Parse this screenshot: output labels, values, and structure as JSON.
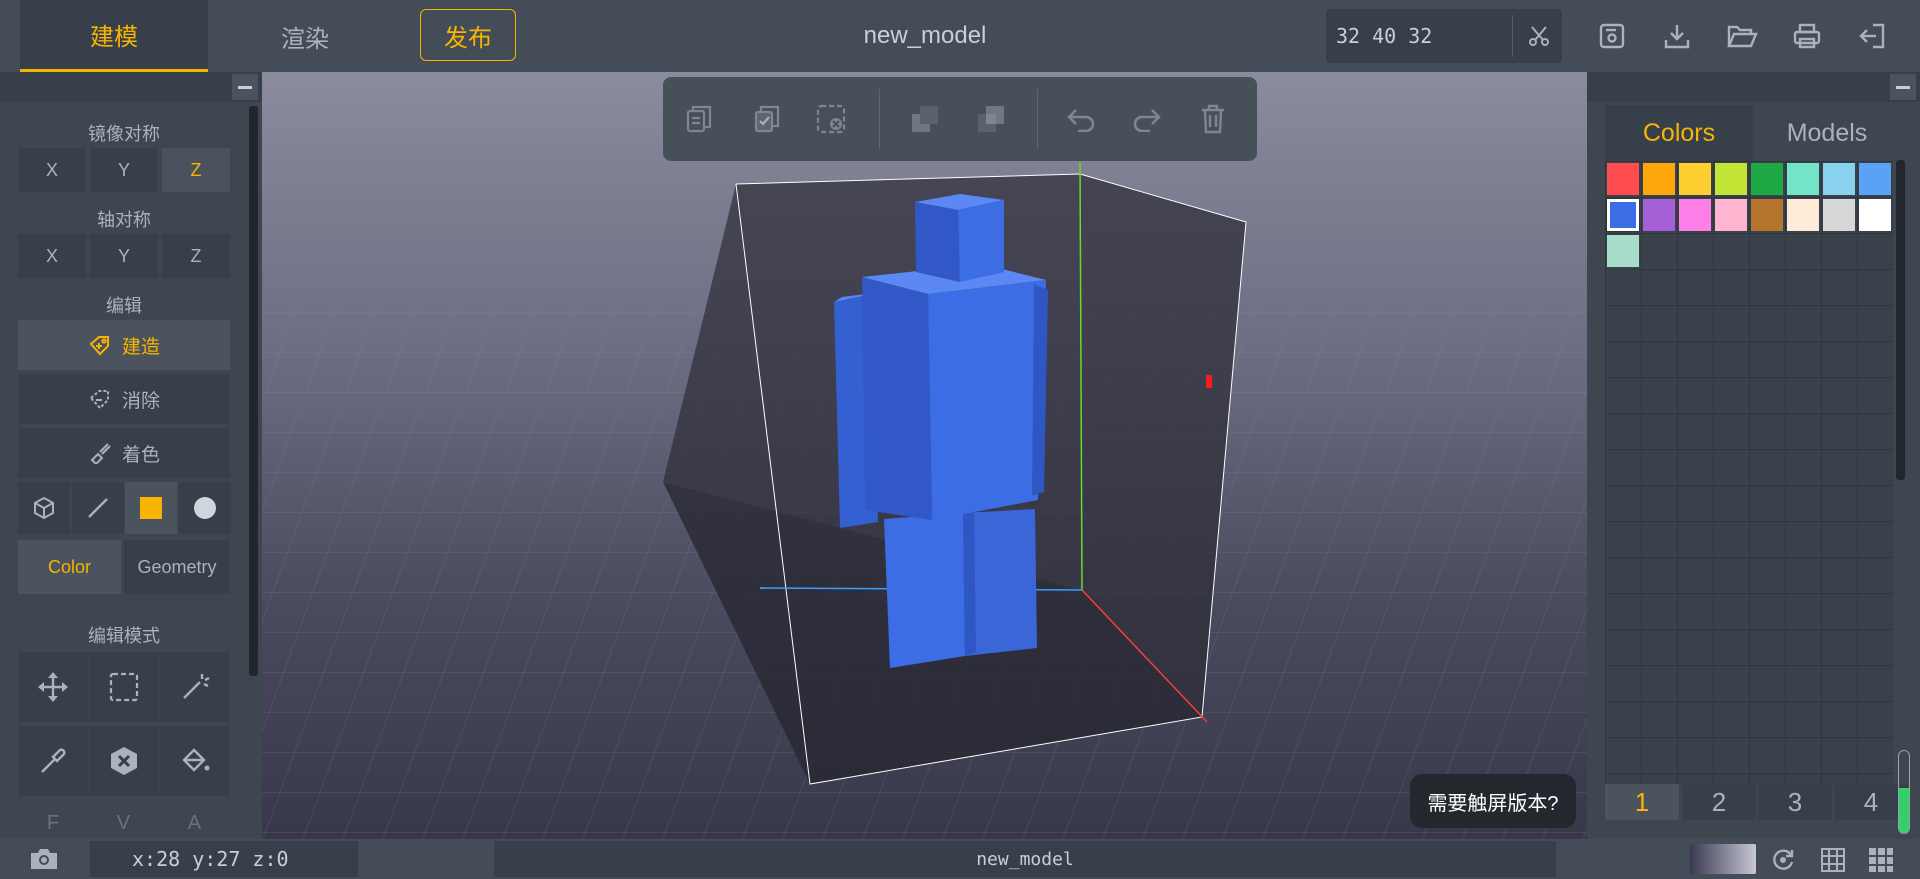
{
  "topbar": {
    "tab_model": "建模",
    "tab_render": "渲染",
    "publish": "发布",
    "title": "new_model",
    "dims": "32 40 32",
    "icons": [
      "scissors-icon",
      "save-icon",
      "download-icon",
      "folder-open-icon",
      "print-icon",
      "logout-icon"
    ]
  },
  "left": {
    "mirror_label": "镜像对称",
    "mirror_axes": [
      "X",
      "Y",
      "Z"
    ],
    "mirror_active": "Z",
    "axis_label": "轴对称",
    "axis_axes": [
      "X",
      "Y",
      "Z"
    ],
    "edit_label": "编辑",
    "build": "建造",
    "erase": "消除",
    "paint": "着色",
    "color_tab": "Color",
    "geometry_tab": "Geometry",
    "edit_mode_label": "编辑模式",
    "ghost_letters": [
      "F",
      "V",
      "A"
    ]
  },
  "viewport": {
    "touch_tip": "需要触屏版本?",
    "accent_color": "#f7b400",
    "model_color": "#3d6de4"
  },
  "right": {
    "tab_colors": "Colors",
    "tab_models": "Models",
    "palette": [
      "#ff4d4f",
      "#ffa60a",
      "#ffcf32",
      "#c3e536",
      "#1fa846",
      "#72e4c8",
      "#88d2f0",
      "#5aa2f5",
      "#3d6de4",
      "#a560d8",
      "#ff7fe8",
      "#ffb4cf",
      "#b4742b",
      "#fdebd8",
      "#d7d7d7",
      "#ffffff",
      "#a6dcc8"
    ],
    "selected_index": 8,
    "pages": [
      "1",
      "2",
      "3",
      "4"
    ],
    "active_page": "1",
    "meter_level": 0.55
  },
  "bottom": {
    "coords": "x:28 y:27 z:0",
    "status_title": "new_model"
  }
}
